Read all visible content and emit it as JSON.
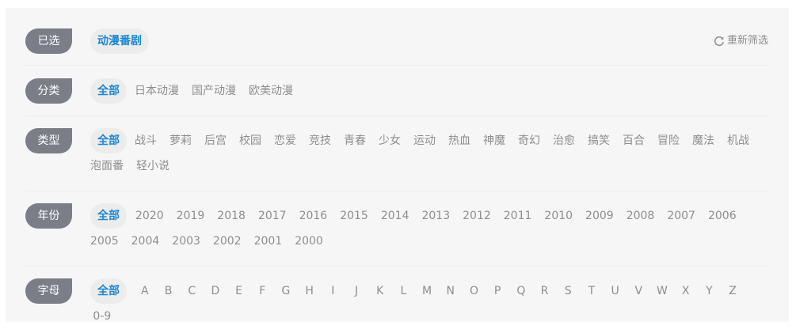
{
  "selected": {
    "label": "已选",
    "tags": [
      "动漫番剧"
    ],
    "reset_label": "重新筛选"
  },
  "category": {
    "label": "分类",
    "options": [
      "全部",
      "日本动漫",
      "国产动漫",
      "欧美动漫"
    ],
    "active": "全部"
  },
  "genre": {
    "label": "类型",
    "options": [
      "全部",
      "战斗",
      "萝莉",
      "后宫",
      "校园",
      "恋爱",
      "竞技",
      "青春",
      "少女",
      "运动",
      "热血",
      "神魔",
      "奇幻",
      "治愈",
      "搞笑",
      "百合",
      "冒险",
      "魔法",
      "机战",
      "泡面番",
      "轻小说"
    ],
    "active": "全部"
  },
  "year": {
    "label": "年份",
    "options": [
      "全部",
      "2020",
      "2019",
      "2018",
      "2017",
      "2016",
      "2015",
      "2014",
      "2013",
      "2012",
      "2011",
      "2010",
      "2009",
      "2008",
      "2007",
      "2006",
      "2005",
      "2004",
      "2003",
      "2002",
      "2001",
      "2000"
    ],
    "active": "全部"
  },
  "letter": {
    "label": "字母",
    "options": [
      "全部",
      "A",
      "B",
      "C",
      "D",
      "E",
      "F",
      "G",
      "H",
      "I",
      "J",
      "K",
      "L",
      "M",
      "N",
      "O",
      "P",
      "Q",
      "R",
      "S",
      "T",
      "U",
      "V",
      "W",
      "X",
      "Y",
      "Z",
      "0-9"
    ],
    "active": "全部"
  },
  "icons": {
    "reset": "refresh-icon"
  },
  "colors": {
    "accent": "#1e86d1",
    "label_bg": "#7b7d87",
    "panel_bg": "#f6f6f6",
    "muted_text": "#8e8e8e"
  }
}
